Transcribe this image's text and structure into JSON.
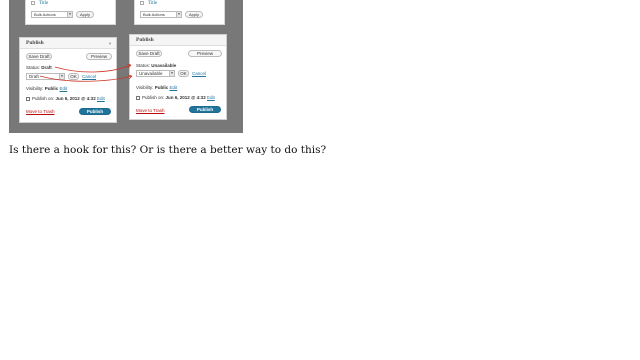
{
  "left": {
    "table": {
      "title": "Title",
      "bulk_actions": "Bulk Actions",
      "apply": "Apply"
    },
    "publish": {
      "header": "Publish",
      "save_draft": "Save Draft",
      "preview": "Preview",
      "status_label": "Status:",
      "status_value": "Draft",
      "select_value": "Draft",
      "ok": "OK",
      "cancel": "Cancel",
      "visibility_label": "Visibility:",
      "visibility_value": "Public",
      "visibility_edit": "Edit",
      "publish_on_label": "Publish on:",
      "publish_on_value": "Jun 6, 2012 @ 4:32",
      "publish_on_edit": "Edit",
      "move_to_trash": "Move to Trash",
      "publish_button": "Publish"
    }
  },
  "right": {
    "table": {
      "title": "Title",
      "bulk_actions": "Bulk Actions",
      "apply": "Apply"
    },
    "publish": {
      "header": "Publish",
      "save_draft": "Save Draft",
      "preview": "Preview",
      "status_label": "Status:",
      "status_value": "Unavailable",
      "select_value": "Unavailable",
      "ok": "OK",
      "cancel": "Cancel",
      "visibility_label": "Visibility:",
      "visibility_value": "Public",
      "visibility_edit": "Edit",
      "publish_on_label": "Publish on:",
      "publish_on_value": "Jun 6, 2012 @ 4:32",
      "publish_on_edit": "Edit",
      "move_to_trash": "Move to Trash",
      "publish_button": "Publish"
    }
  },
  "question": "Is there a hook for this? Or is there a better way to do this?",
  "colors": {
    "link": "#21759b",
    "publish_button": "#21759b",
    "trash": "#bc0b0b",
    "annotation": "#cc3322",
    "frame": "#787878"
  }
}
